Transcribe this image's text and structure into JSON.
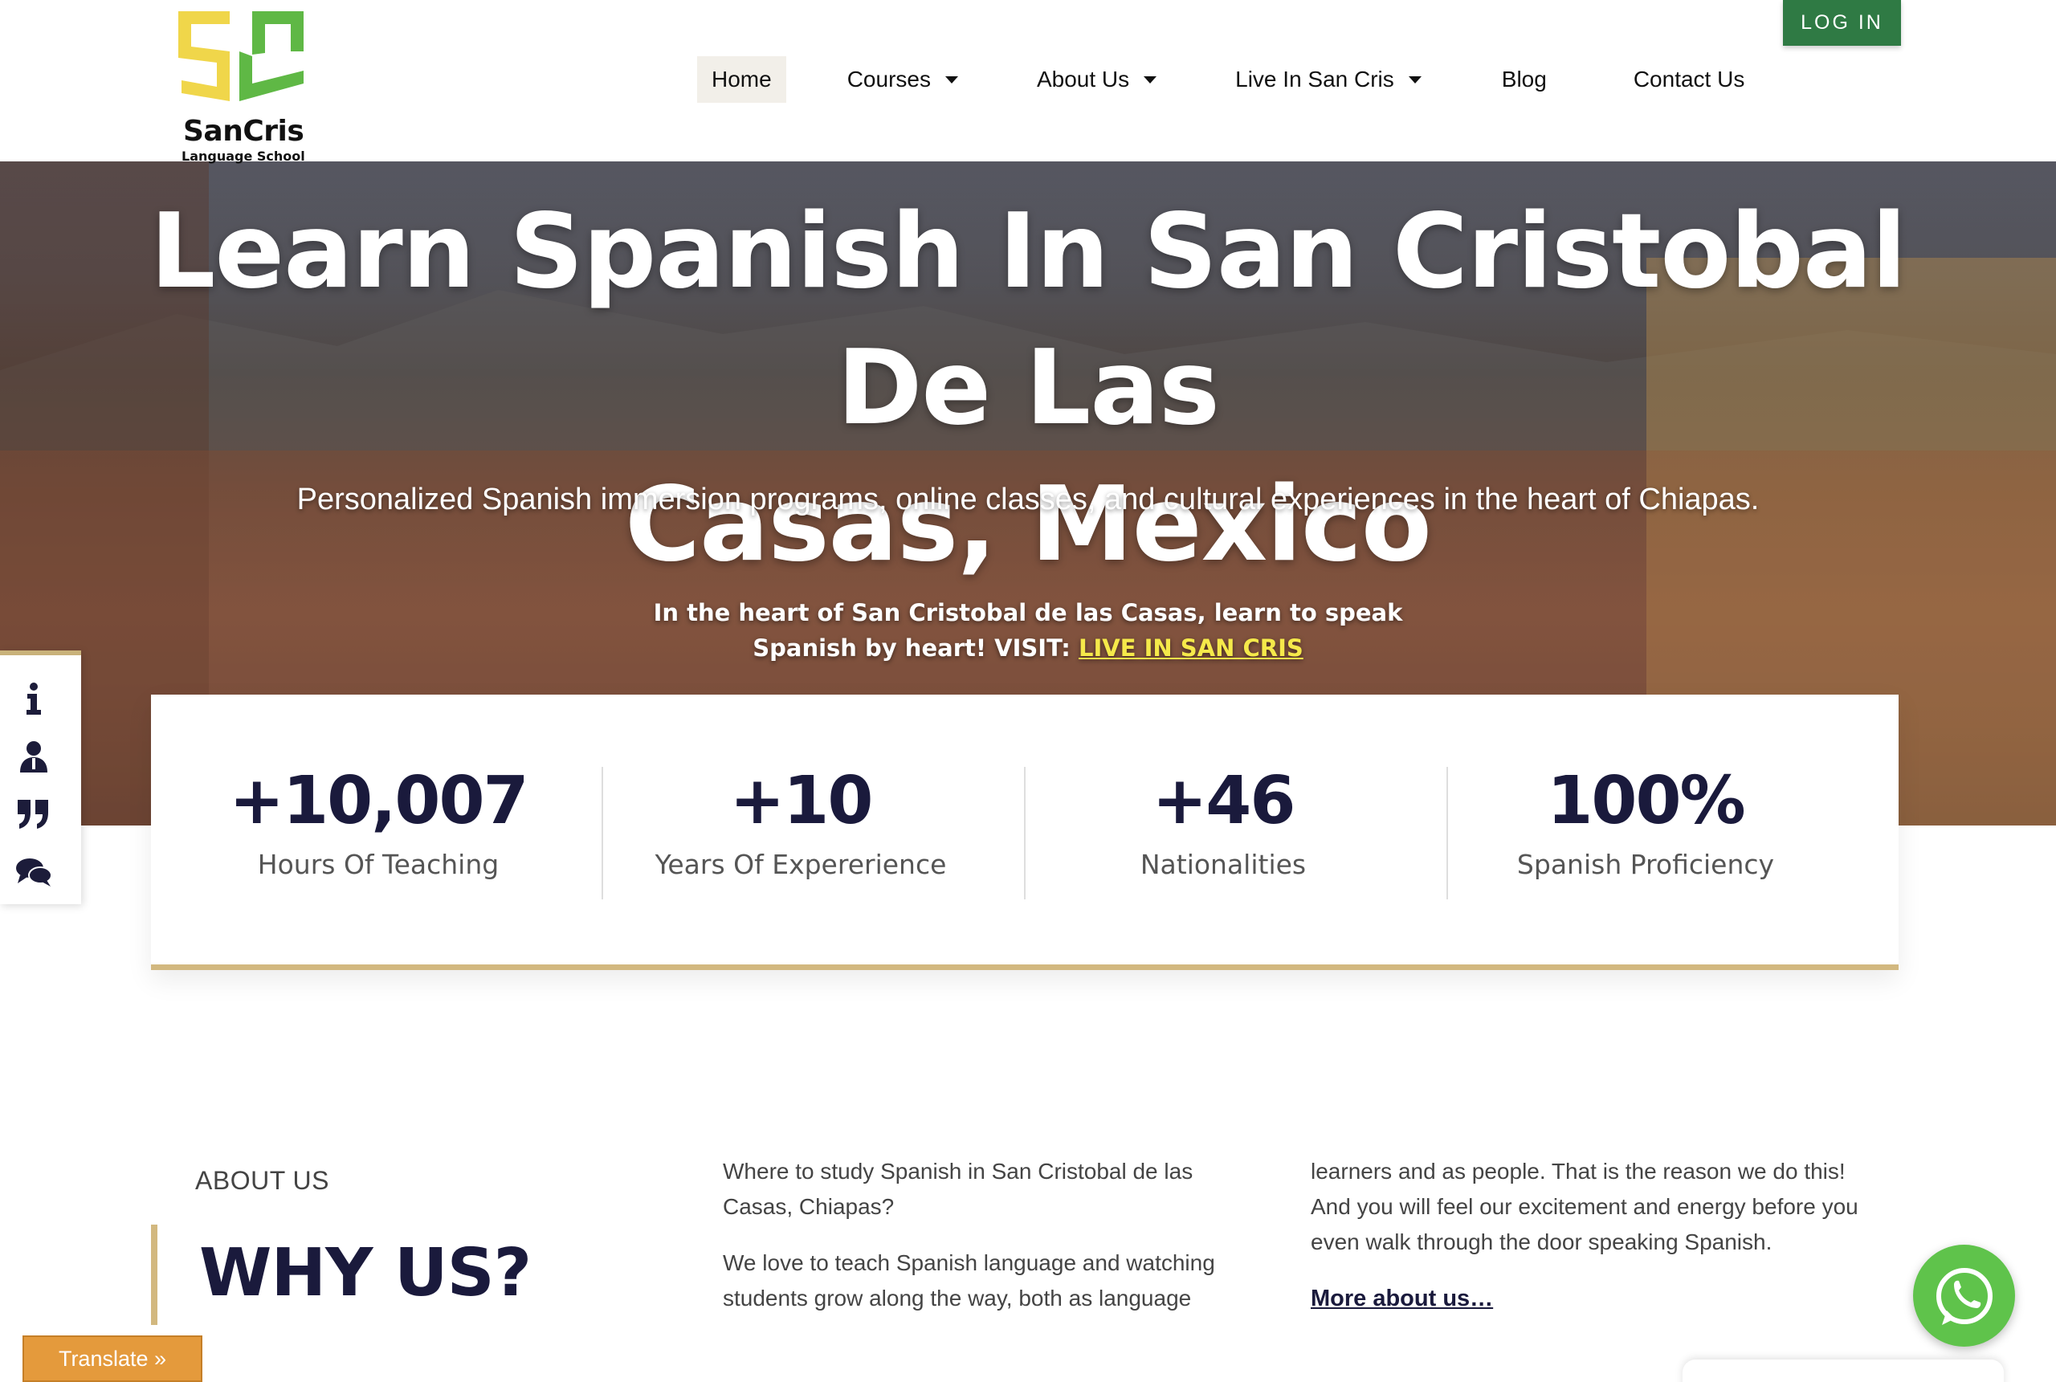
{
  "brand": {
    "name": "SanCris",
    "tagline": "Language School",
    "colors": {
      "green": "#2f7a44",
      "gold": "#d2b87f",
      "navy": "#1a1a3c",
      "yellow": "#f5e94a"
    }
  },
  "header": {
    "login_label": "LOG IN",
    "nav": [
      {
        "label": "Home",
        "active": true,
        "dropdown": false
      },
      {
        "label": "Courses",
        "active": false,
        "dropdown": true
      },
      {
        "label": "About Us",
        "active": false,
        "dropdown": true
      },
      {
        "label": "Live In San Cris",
        "active": false,
        "dropdown": true
      },
      {
        "label": "Blog",
        "active": false,
        "dropdown": false
      },
      {
        "label": "Contact Us",
        "active": false,
        "dropdown": false
      }
    ]
  },
  "hero": {
    "title_line1": "Learn Spanish In San Cristobal De Las",
    "title_line2": "Casas, Mexico",
    "subtitle": "Personalized Spanish immersion programs, online classes, and cultural experiences in the heart of Chiapas.",
    "note_line1": "In the heart of San Cristobal de las Casas, learn to speak",
    "note_line2_prefix": "Spanish by heart! VISIT: ",
    "note_link": "LIVE IN SAN CRIS"
  },
  "side_toolbar": {
    "icons": [
      "info-icon",
      "user-icon",
      "quote-icon",
      "chat-icon"
    ]
  },
  "stats": [
    {
      "value": "+10,007",
      "label": "Hours Of Teaching"
    },
    {
      "value": "+10",
      "label": "Years Of Expererience"
    },
    {
      "value": "+46",
      "label": "Nationalities"
    },
    {
      "value": "100%",
      "label": "Spanish Proficiency"
    }
  ],
  "about": {
    "kicker": "ABOUT US",
    "title": "WHY US?",
    "col1_p1": "Where to study Spanish in San Cristobal de las Casas, Chiapas?",
    "col1_p2": "We love to teach Spanish language and watching students grow along the way, both as language",
    "col2_p1": "learners and as people. That is the reason we do this! And you will feel our excitement and energy before you even walk through the door speaking Spanish.",
    "more_link": "More about us…"
  },
  "floating": {
    "translate_label": "Translate »",
    "whatsapp_icon": "whatsapp-icon"
  }
}
